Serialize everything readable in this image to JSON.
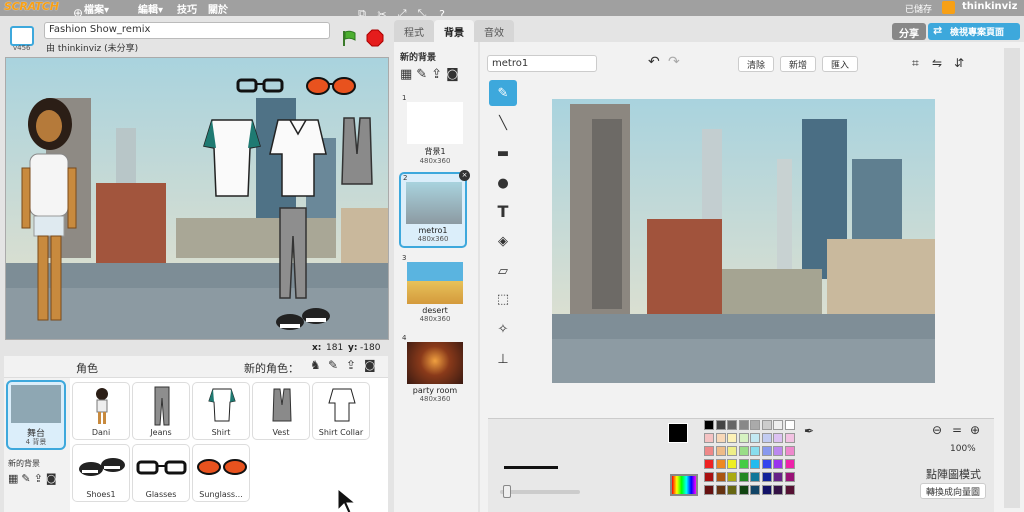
{
  "menubar": {
    "logo": "SCRATCH",
    "file": "檔案▾",
    "edit": "編輯▾",
    "tips": "技巧",
    "about": "關於",
    "saved": "已儲存",
    "user": "thinkinviz"
  },
  "project": {
    "title": "Fashion Show_remix",
    "author": "由 thinkinviz (未分享)",
    "version": "v456"
  },
  "header_buttons": {
    "share": "分享",
    "see_project": "檢視專案頁面"
  },
  "stage": {
    "x_label": "x:",
    "x": "181",
    "y_label": "y:",
    "y": "-180"
  },
  "sprites": {
    "header": "角色",
    "new_sprite": "新的角色：",
    "stage_label": "舞台",
    "stage_count": "4 背景",
    "new_backdrop": "新的背景",
    "items": [
      "Dani",
      "Jeans",
      "Shirt",
      "Vest",
      "Shirt Collar",
      "Shoes1",
      "Glasses",
      "Sunglass..."
    ]
  },
  "tabs": {
    "scripts": "程式",
    "backdrops": "背景",
    "sounds": "音效"
  },
  "backdrops": {
    "new": "新的背景",
    "items": [
      {
        "num": "1",
        "name": "背景1",
        "dim": "480x360"
      },
      {
        "num": "2",
        "name": "metro1",
        "dim": "480x360"
      },
      {
        "num": "3",
        "name": "desert",
        "dim": "480x360"
      },
      {
        "num": "4",
        "name": "party room",
        "dim": "480x360"
      }
    ]
  },
  "editor": {
    "name": "metro1",
    "clear": "清除",
    "add": "新增",
    "import": "匯入",
    "zoom": "100%",
    "mode": "點陣圖模式",
    "convert": "轉換成向量圖"
  },
  "colors": {
    "accent": "#3da8dc",
    "scratch_orange": "#f7a016",
    "topbar": "#a0a0a0"
  }
}
